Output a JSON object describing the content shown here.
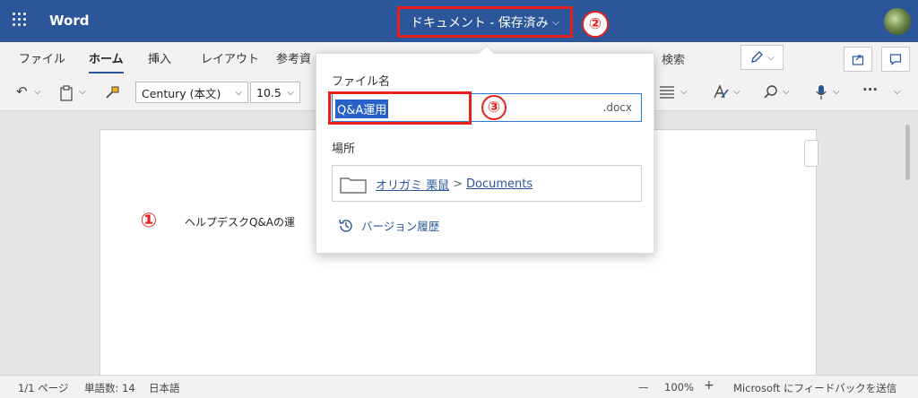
{
  "app": {
    "name": "Word"
  },
  "title": {
    "doc_name": "ドキュメント - 保存済み",
    "chevron": "⌵"
  },
  "annotations": {
    "one": "①",
    "two": "②",
    "three": "③"
  },
  "ribbon": {
    "tabs": [
      "ファイル",
      "ホーム",
      "挿入",
      "レイアウト",
      "参考資"
    ],
    "active_tab": "ホーム",
    "search": "検索",
    "font_name": "Century (本文)",
    "font_size": "10.5",
    "chevron": "⌵",
    "more": "···"
  },
  "popup": {
    "filename_label": "ファイル名",
    "filename_value": "Q&A運用",
    "filename_ext": ".docx",
    "location_label": "場所",
    "location_user": "オリガミ 栗鼠",
    "location_sep": ">",
    "location_folder": "Documents",
    "history": "バージョン履歴"
  },
  "document": {
    "text": "ヘルプデスクQ&Aの運"
  },
  "status": {
    "page": "1/1 ページ",
    "words": "単語数: 14",
    "language": "日本語",
    "zoom_minus": "—",
    "zoom": "100%",
    "zoom_plus": "+",
    "feedback": "Microsoft にフィードバックを送信"
  },
  "colors": {
    "accent": "#2b579a",
    "highlight": "#e8201d"
  }
}
